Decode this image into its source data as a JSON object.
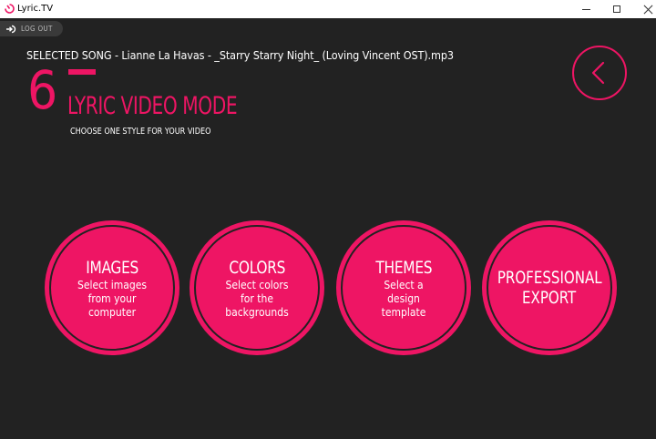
{
  "window": {
    "title": "Lyric.TV",
    "icons": {
      "app": "lyric-tv-logo-icon",
      "minimize": "minimize-icon",
      "maximize": "maximize-icon",
      "close": "close-icon"
    }
  },
  "header": {
    "logout_label": "LOG OUT",
    "logout_icon": "logout-icon",
    "selected_song": "SELECTED SONG - Lianne La Havas - _Starry Starry Night_ (Loving Vincent OST).mp3",
    "step_number": "6",
    "mode_title": "LYRIC VIDEO MODE",
    "mode_subtitle": "CHOOSE ONE STYLE FOR YOUR VIDEO",
    "back_icon": "chevron-left-icon"
  },
  "options": [
    {
      "title": "IMAGES",
      "lines": [
        "Select images",
        "from your",
        "computer"
      ]
    },
    {
      "title": "COLORS",
      "lines": [
        "Select colors",
        "for the",
        "backgrounds"
      ]
    },
    {
      "title": "THEMES",
      "lines": [
        "Select a",
        "design",
        "template"
      ]
    },
    {
      "title_lines": [
        "PROFESSIONAL",
        "EXPORT"
      ]
    }
  ],
  "colors": {
    "accent": "#ee1564",
    "background": "#222222",
    "titlebar": "#ffffff"
  }
}
